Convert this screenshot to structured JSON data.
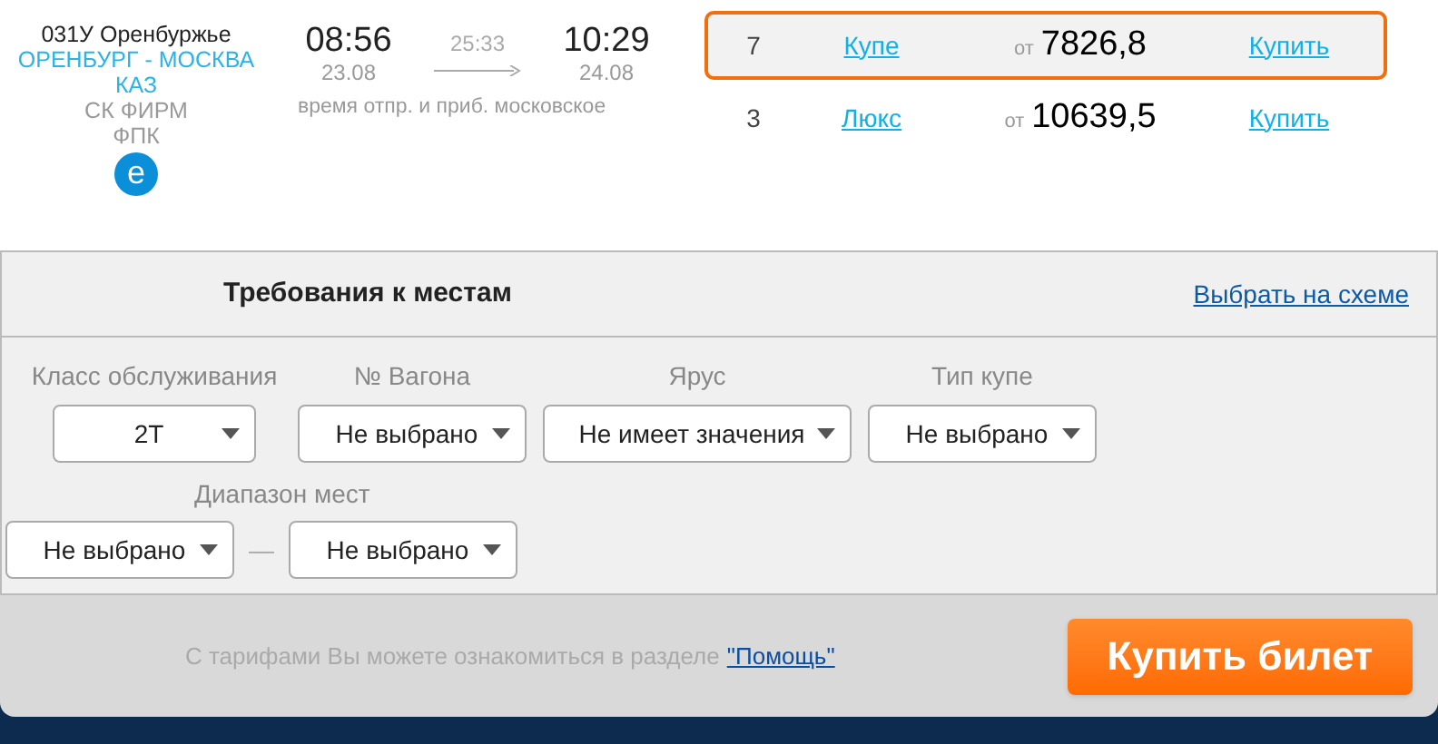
{
  "train": {
    "number": "031У Оренбуржье",
    "route": "ОРЕНБУРГ - МОСКВА",
    "route_code": "КАЗ",
    "category": "СК ФИРМ",
    "carrier": "ФПК",
    "e_ticket_badge": "e"
  },
  "schedule": {
    "departure_time": "08:56",
    "departure_date": "23.08",
    "duration": "25:33",
    "arrival_time": "10:29",
    "arrival_date": "24.08",
    "note": "время отпр. и приб. московское"
  },
  "cars": [
    {
      "seats": "7",
      "type": "Купе",
      "price_prefix": "от",
      "price": "7826,8",
      "action": "Купить",
      "selected": true
    },
    {
      "seats": "3",
      "type": "Люкс",
      "price_prefix": "от",
      "price": "10639,5",
      "action": "Купить",
      "selected": false
    }
  ],
  "requirements": {
    "title": "Требования к местам",
    "scheme_link": "Выбрать на схеме",
    "fields": [
      {
        "label": "Класс обслуживания",
        "value": "2Т"
      },
      {
        "label": "№ Вагона",
        "value": "Не выбрано"
      },
      {
        "label": "Ярус",
        "value": "Не имеет значения"
      },
      {
        "label": "Тип купе",
        "value": "Не выбрано"
      }
    ],
    "range": {
      "label": "Диапазон мест",
      "from": "Не выбрано",
      "separator": "—",
      "to": "Не выбрано"
    }
  },
  "footer": {
    "note": "С тарифами Вы можете ознакомиться в разделе",
    "help_link": "\"Помощь\"",
    "buy_button": "Купить билет"
  }
}
